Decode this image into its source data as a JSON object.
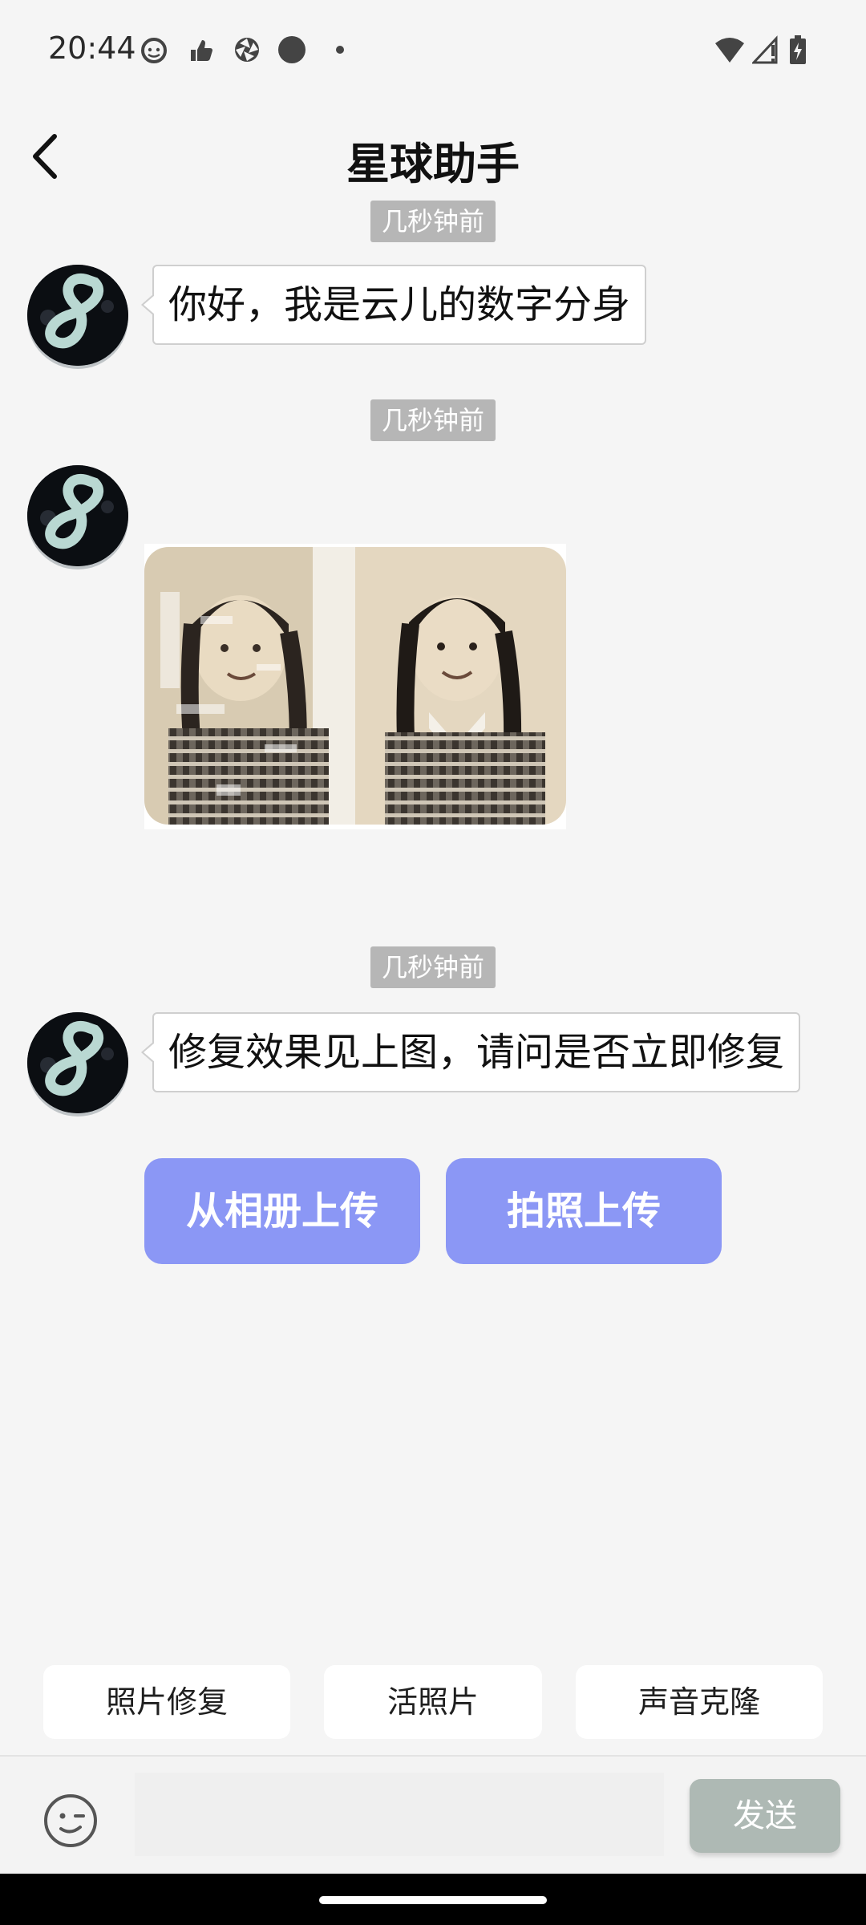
{
  "status_bar": {
    "time": "20:44",
    "left_icons": [
      "face-icon",
      "thumb-icon",
      "aperture-icon",
      "dot-filled-icon",
      "small-dot-icon"
    ],
    "right_icons": [
      "wifi-icon",
      "signal-icon",
      "battery-icon"
    ]
  },
  "header": {
    "title": "星球助手",
    "back_icon": "chevron-left-icon"
  },
  "messages": [
    {
      "time": "几秒钟前",
      "type": "text",
      "text": "你好，我是云儿的数字分身"
    },
    {
      "time": "几秒钟前",
      "type": "image"
    },
    {
      "time": "几秒钟前",
      "type": "text",
      "text": "修复效果见上图，请问是否立即修复"
    }
  ],
  "actions": {
    "upload_album": "从相册上传",
    "upload_camera": "拍照上传"
  },
  "quick_chips": [
    "照片修复",
    "活照片",
    "声音克隆"
  ],
  "input_bar": {
    "placeholder": "",
    "send_label": "发送",
    "emoji_icon": "emoji-icon"
  },
  "colors": {
    "accent": "#8b97f5",
    "send_disabled": "#aeb9b4",
    "time_chip": "#b6b6b6",
    "background": "#f5f5f5"
  }
}
